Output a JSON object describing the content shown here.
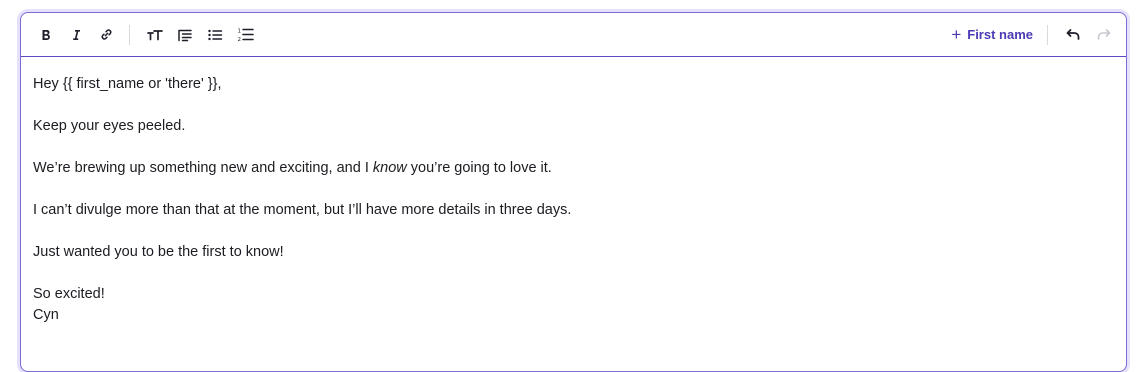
{
  "toolbar": {
    "bold_icon": "bold-icon",
    "italic_icon": "italic-icon",
    "link_icon": "link-icon",
    "font_size_icon": "font-size-icon",
    "indent_icon": "indent-icon",
    "bullet_list_icon": "bullet-list-icon",
    "numbered_list_icon": "numbered-list-icon",
    "insert_variable_label": "First name",
    "undo_icon": "undo-icon",
    "redo_icon": "redo-icon"
  },
  "colors": {
    "accent": "#4b3bb5",
    "border": "#7b6cd6",
    "text": "#1c1c22"
  },
  "body": {
    "greeting": "Hey {{ first_name or 'there' }},",
    "line1": "Keep your eyes peeled.",
    "line2_before": "We’re brewing up something new and exciting, and I ",
    "line2_emph": "know",
    "line2_after": " you’re going to love it.",
    "line3": "I can’t divulge more than that at the moment, but I’ll have more details in three days.",
    "line4": "Just wanted you to be the first to know!",
    "signoff": "So excited!",
    "signature": "Cyn"
  }
}
